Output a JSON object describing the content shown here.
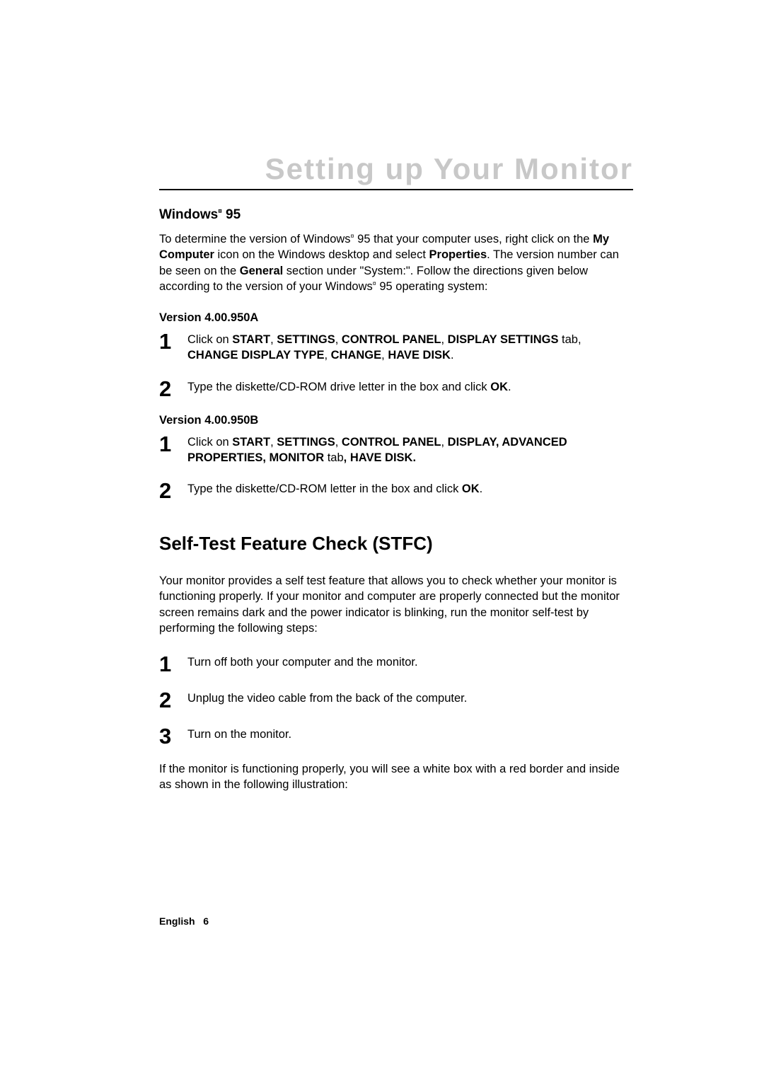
{
  "title": "Setting up Your Monitor",
  "windows95": {
    "heading_prefix": "Windows",
    "heading_reg": "¤",
    "heading_suffix": " 95",
    "intro_1": "To determine the version of Windows",
    "intro_reg1": "¤",
    "intro_2": " 95 that your computer uses, right click on the ",
    "intro_bold1": "My Computer",
    "intro_3": " icon on the Windows desktop and select ",
    "intro_bold2": "Properties",
    "intro_4": ". The version number can be seen on the ",
    "intro_bold3": "General",
    "intro_5": " section under \"System:\". Follow the directions given below according to the version of your Windows",
    "intro_reg2": "¤",
    "intro_6": " 95 operating system:"
  },
  "versionA": {
    "heading": "Version 4.00.950A",
    "step1_num": "1",
    "step1_pre": "Click on ",
    "step1_b1": "START",
    "step1_s1": ", ",
    "step1_b2": "SETTINGS",
    "step1_s2": ", ",
    "step1_b3": "CONTROL PANEL",
    "step1_s3": ", ",
    "step1_b4": "DISPLAY SETTINGS",
    "step1_s4": " tab, ",
    "step1_b5": "CHANGE DISPLAY TYPE",
    "step1_s5": ", ",
    "step1_b6": "CHANGE",
    "step1_s6": ", ",
    "step1_b7": "HAVE DISK",
    "step1_s7": ".",
    "step2_num": "2",
    "step2_pre": "Type the diskette/CD-ROM drive letter in the box and click ",
    "step2_b1": "OK",
    "step2_post": "."
  },
  "versionB": {
    "heading": "Version 4.00.950B",
    "step1_num": "1",
    "step1_pre": "Click on ",
    "step1_b1": "START",
    "step1_s1": ", ",
    "step1_b2": "SETTINGS",
    "step1_s2": ", ",
    "step1_b3": "CONTROL PANEL",
    "step1_s3": ", ",
    "step1_b4": "DISPLAY, ADVANCED PROPERTIES, MONITOR",
    "step1_s4": " tab",
    "step1_b5": ", HAVE DISK.",
    "step2_num": "2",
    "step2_pre": "Type the diskette/CD-ROM letter in the box and click ",
    "step2_b1": "OK",
    "step2_post": "."
  },
  "stfc": {
    "title": "Self-Test Feature Check (STFC)",
    "para1": "Your monitor provides a self test feature that allows you to check whether your monitor is functioning properly. If your monitor and computer are properly connected but the monitor screen remains dark and the power indicator is blinking, run the monitor self-test by performing the following steps:",
    "step1_num": "1",
    "step1_text": "Turn off both your computer and the monitor.",
    "step2_num": "2",
    "step2_text": "Unplug the video cable from the back of the computer.",
    "step3_num": "3",
    "step3_text": "Turn on the monitor.",
    "para2": "If the monitor is functioning properly, you will see a white box with a red border and inside as shown in the following illustration:"
  },
  "footer": {
    "lang": "English",
    "page": "6"
  }
}
